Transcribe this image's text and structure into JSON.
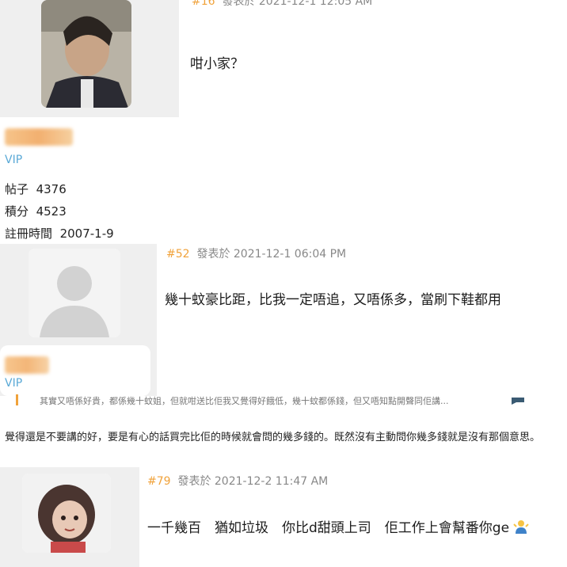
{
  "posts": [
    {
      "number": "#16",
      "posted": "發表於 2021-12-1 12:05 AM",
      "content": "咁小家？",
      "vip": "VIP",
      "stats": {
        "posts_label": "帖子",
        "posts_value": "4376",
        "credits_label": "積分",
        "credits_value": "4523",
        "reg_label": "註冊時間",
        "reg_value": "2007-1-9"
      }
    },
    {
      "number": "#52",
      "posted": "發表於 2021-12-1 06:04 PM",
      "content": "幾十蚊豪比距，比我一定唔追，又唔係多，當刷下鞋都用",
      "vip": "VIP"
    },
    {
      "number": "#79",
      "posted": "發表於 2021-12-2 11:47 AM",
      "content": "一千幾百　猶如垃圾　你比d甜頭上司　佢工作上會幫番你ge"
    }
  ],
  "quote_text": "其實又唔係好貴，都係幾十蚊姐，但就咁送比佢我又覺得好餓低，幾十蚊都係錢，但又唔知點開聲同佢講...",
  "reply_text": "覺得還是不要講的好，要是有心的話買完比佢的時候就會問的幾多錢的。既然沒有主動問你幾多錢就是沒有那個意思。",
  "colors": {
    "accent": "#f0a23a",
    "vip": "#5aa9d6",
    "sidebar": "#efefef"
  },
  "icons": {
    "shrug": "person-shrugging-emoji"
  }
}
